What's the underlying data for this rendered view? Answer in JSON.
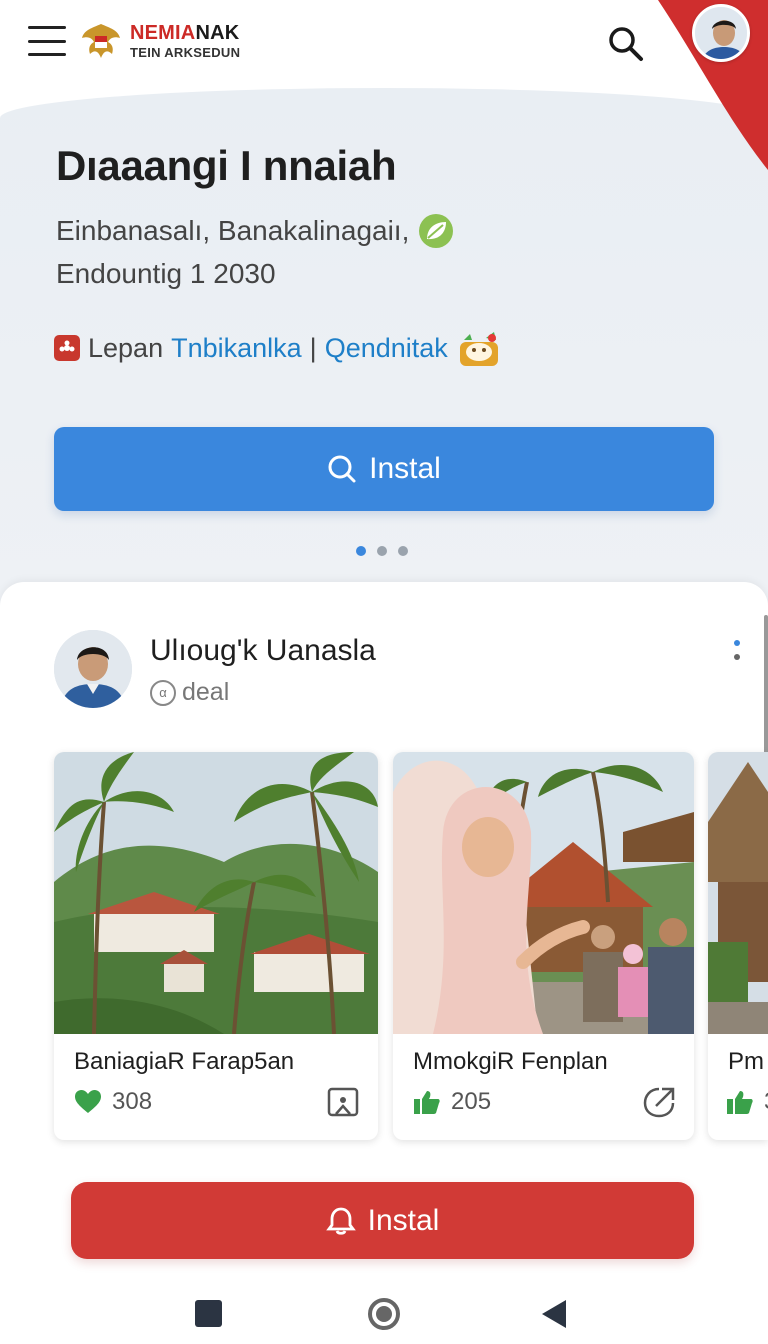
{
  "app": {
    "logo_line1_red": "NEMIA",
    "logo_line1_dark": "NAK",
    "logo_line2": "TEIN ARKSEDUN"
  },
  "hero": {
    "title": "Dıaaangi I nnaiah",
    "subtitle": "Einbanasalı, Banakalinagaiı,",
    "date": "Endountig 1 2030",
    "tag_plain": "Lepan",
    "tag_link1": "Tnbikanlka",
    "tag_separator": "|",
    "tag_link2": "Qendnitak",
    "install_label": "Instal"
  },
  "carousel": {
    "dots": 3,
    "active_index": 0
  },
  "profile": {
    "name": "Ulıoug'k Uanasla",
    "handle_prefix": "α",
    "handle": "deal"
  },
  "posts": [
    {
      "title": "BaniagiaR Farap5an",
      "count": "308",
      "reaction": "heart-icon"
    },
    {
      "title": "MmokgiR Fenplan",
      "count": "205",
      "reaction": "thumbs-up-icon"
    },
    {
      "title": "Pm",
      "count": "3",
      "reaction": "thumbs-up-icon"
    }
  ],
  "secondary_install_label": "Instal",
  "colors": {
    "primary_blue": "#3a87dd",
    "accent_red": "#d13a36",
    "link_blue": "#1e7fc8",
    "like_green": "#3aa14a"
  }
}
